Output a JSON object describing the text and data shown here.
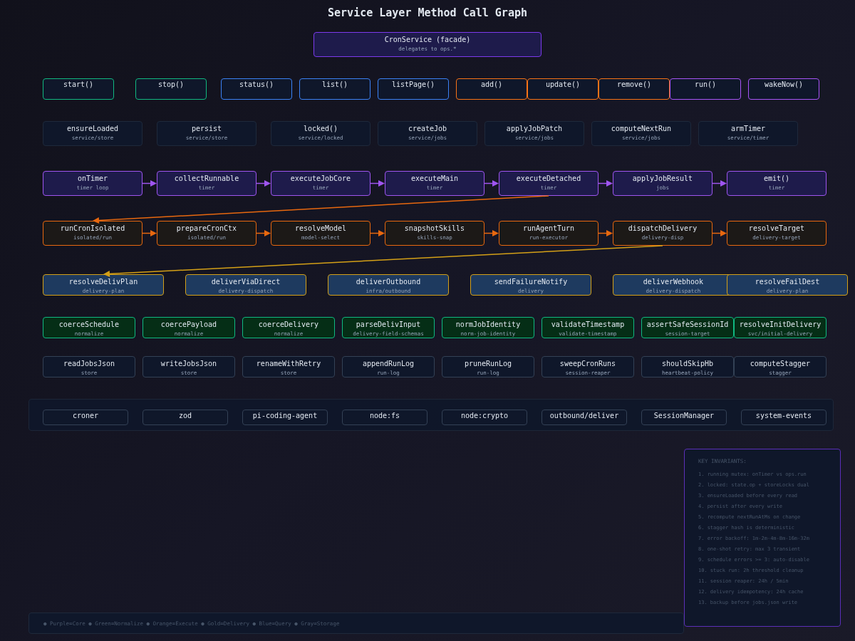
{
  "title": "Service Layer Method Call Graph",
  "facade": {
    "label": "CronService (facade)",
    "sub": "delegates to ops.*"
  },
  "rows": [
    {
      "kind": "api",
      "nodes": [
        {
          "label": "start()",
          "color": "#10b981"
        },
        {
          "label": "stop()",
          "color": "#10b981"
        },
        {
          "label": "status()",
          "color": "#3b82f6"
        },
        {
          "label": "list()",
          "color": "#3b82f6"
        },
        {
          "label": "listPage()",
          "color": "#3b82f6"
        },
        {
          "label": "add()",
          "color": "#f97316"
        },
        {
          "label": "update()",
          "color": "#f97316"
        },
        {
          "label": "remove()",
          "color": "#f97316"
        },
        {
          "label": "run()",
          "color": "#a855f7"
        },
        {
          "label": "wakeNow()",
          "color": "#a855f7"
        }
      ]
    },
    {
      "kind": "service",
      "nodes": [
        {
          "label": "ensureLoaded",
          "sub": "service/store"
        },
        {
          "label": "persist",
          "sub": "service/store"
        },
        {
          "label": "locked()",
          "sub": "service/locked"
        },
        {
          "label": "createJob",
          "sub": "service/jobs"
        },
        {
          "label": "applyJobPatch",
          "sub": "service/jobs"
        },
        {
          "label": "computeNextRun",
          "sub": "service/jobs"
        },
        {
          "label": "armTimer",
          "sub": "service/timer"
        }
      ]
    },
    {
      "kind": "core",
      "chained": true,
      "nodes": [
        {
          "label": "onTimer",
          "sub": "timer loop"
        },
        {
          "label": "collectRunnable",
          "sub": "timer"
        },
        {
          "label": "executeJobCore",
          "sub": "timer"
        },
        {
          "label": "executeMain",
          "sub": "timer"
        },
        {
          "label": "executeDetached",
          "sub": "timer",
          "feeds_next_row": true
        },
        {
          "label": "applyJobResult",
          "sub": "jobs"
        },
        {
          "label": "emit()",
          "sub": "timer"
        }
      ]
    },
    {
      "kind": "execute",
      "chained": true,
      "nodes": [
        {
          "label": "runCronIsolated",
          "sub": "isolated/run"
        },
        {
          "label": "prepareCronCtx",
          "sub": "isolated/run"
        },
        {
          "label": "resolveModel",
          "sub": "model-select"
        },
        {
          "label": "snapshotSkills",
          "sub": "skills-snap"
        },
        {
          "label": "runAgentTurn",
          "sub": "run-executor"
        },
        {
          "label": "dispatchDelivery",
          "sub": "delivery-disp",
          "feeds_next_row": true
        },
        {
          "label": "resolveTarget",
          "sub": "delivery-target"
        }
      ]
    },
    {
      "kind": "delivery",
      "nodes": [
        {
          "label": "resolveDelivPlan",
          "sub": "delivery-plan"
        },
        {
          "label": "deliverViaDirect",
          "sub": "delivery-dispatch"
        },
        {
          "label": "deliverOutbound",
          "sub": "infra/outbound"
        },
        {
          "label": "sendFailureNotify",
          "sub": "delivery"
        },
        {
          "label": "deliverWebhook",
          "sub": "delivery-dispatch"
        },
        {
          "label": "resolveFailDest",
          "sub": "delivery-plan"
        }
      ]
    },
    {
      "kind": "normalize",
      "nodes": [
        {
          "label": "coerceSchedule",
          "sub": "normalize"
        },
        {
          "label": "coercePayload",
          "sub": "normalize"
        },
        {
          "label": "coerceDelivery",
          "sub": "normalize"
        },
        {
          "label": "parseDelivInput",
          "sub": "delivery-field-schemas"
        },
        {
          "label": "normJobIdentity",
          "sub": "norm-job-identity"
        },
        {
          "label": "validateTimestamp",
          "sub": "validate-timestamp"
        },
        {
          "label": "assertSafeSessionId",
          "sub": "session-target"
        },
        {
          "label": "resolveInitDelivery",
          "sub": "svc/initial-delivery"
        }
      ]
    },
    {
      "kind": "storage",
      "nodes": [
        {
          "label": "readJobsJson",
          "sub": "store"
        },
        {
          "label": "writeJobsJson",
          "sub": "store"
        },
        {
          "label": "renameWithRetry",
          "sub": "store"
        },
        {
          "label": "appendRunLog",
          "sub": "run-log"
        },
        {
          "label": "pruneRunLog",
          "sub": "run-log"
        },
        {
          "label": "sweepCronRuns",
          "sub": "session-reaper"
        },
        {
          "label": "shouldSkipHb",
          "sub": "heartbeat-policy"
        },
        {
          "label": "computeStagger",
          "sub": "stagger"
        }
      ]
    }
  ],
  "external": [
    "croner",
    "zod",
    "pi-coding-agent",
    "node:fs",
    "node:crypto",
    "outbound/deliver",
    "SessionManager",
    "system-events"
  ],
  "invariants": {
    "title": "KEY INVARIANTS:",
    "items": [
      "1. running mutex: onTimer vs ops.run",
      "2. locked: state.op + storeLocks dual",
      "3. ensureLoaded before every read",
      "4. persist after every write",
      "5. recompute nextRunAtMs on change",
      "6. stagger hash is deterministic",
      "7. error backoff: 1m-2m-4m-8m-16m-32m",
      "8. one-shot retry: max 3 transient",
      "9. schedule errors >= 3: auto-disable",
      "10. stuck run: 2h threshold cleanup",
      "11. session reaper: 24h / 5min",
      "12. delivery idempotency: 24h cache",
      "13. backup before jobs.json write"
    ]
  },
  "legend": "● Purple=Core ● Green=Normalize ● Orange=Execute ● Gold=Delivery ● Blue=Query ● Gray=Storage"
}
